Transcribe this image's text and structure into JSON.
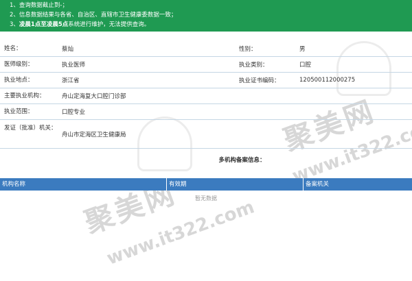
{
  "notice": {
    "line1": "1、查询数据截止到-；",
    "line2": "2、信息数据结果与各省、自治区、直辖市卫生健康委数据一致；",
    "line3_prefix": "3、",
    "line3_bold": "凌晨1点至凌晨5点",
    "line3_suffix": "系统进行维护，无法提供查询。"
  },
  "info": {
    "name_label": "姓名：",
    "name_value": "蔡灿",
    "gender_label": "性别：",
    "gender_value": "男",
    "level_label": "医师级别：",
    "level_value": "执业医师",
    "category_label": "执业类别：",
    "category_value": "口腔",
    "location_label": "执业地点：",
    "location_value": "浙江省",
    "cert_label": "执业证书编码：",
    "cert_value": "120500112000275",
    "institution_label": "主要执业机构：",
    "institution_value": "舟山定海复大口腔门诊部",
    "scope_label": "执业范围：",
    "scope_value": "口腔专业",
    "issuer_label": "发证（批准）机关：",
    "issuer_value": "舟山市定海区卫生健康局"
  },
  "multi": {
    "title": "多机构备案信息：",
    "columns": [
      "机构名称",
      "有效期",
      "备案机关"
    ],
    "empty_text": "暂无数据"
  },
  "watermark": {
    "text": "聚美网",
    "url": "www.it322.com"
  }
}
